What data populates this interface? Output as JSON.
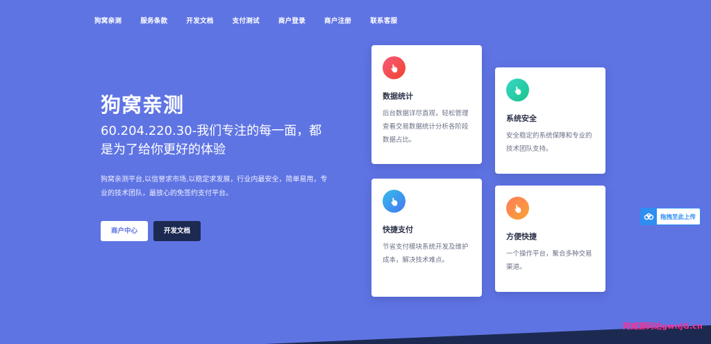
{
  "nav": {
    "items": [
      {
        "label": "狗窝亲测"
      },
      {
        "label": "服务条款"
      },
      {
        "label": "开发文档"
      },
      {
        "label": "支付测试"
      },
      {
        "label": "商户登录"
      },
      {
        "label": "商户注册"
      },
      {
        "label": "联系客服"
      }
    ]
  },
  "hero": {
    "title": "狗窝亲测",
    "subtitle": "60.204.220.30-我们专注的每一面，都是为了给你更好的体验",
    "description": "狗窝亲测平台,以信誉求市场,以稳定求发展，行业内最安全，简单易用，专业的技术团队，最放心的免签约支付平台。",
    "primary_button": "商户中心",
    "secondary_button": "开发文档"
  },
  "features": [
    {
      "title": "数据统计",
      "text": "后台数据详尽直观，轻松管理查看交易数据统计分析各阶段数据占比。",
      "icon": "hand-pointer-icon",
      "color": "#f0442c"
    },
    {
      "title": "系统安全",
      "text": "安全稳定的系统保障和专业的技术团队支持。",
      "icon": "hand-pointer-icon",
      "color": "#18c48a"
    },
    {
      "title": "快捷支付",
      "text": "节省支付模块系统开发及维护成本，解决技术难点。",
      "icon": "hand-pointer-icon",
      "color": "#4577f2"
    },
    {
      "title": "方便快捷",
      "text": "一个操作平台，聚合多种交易渠道。",
      "icon": "hand-pointer-icon",
      "color": "#f9a234"
    }
  ],
  "upload_widget": {
    "label": "拖拽至此上传",
    "icon": "cloud-upload-icon"
  },
  "watermark": "阿威源码站gwnjG.cn",
  "colors": {
    "background": "#5f74e3",
    "dark_button": "#1c2a52",
    "accent": "#2e8ef2"
  }
}
